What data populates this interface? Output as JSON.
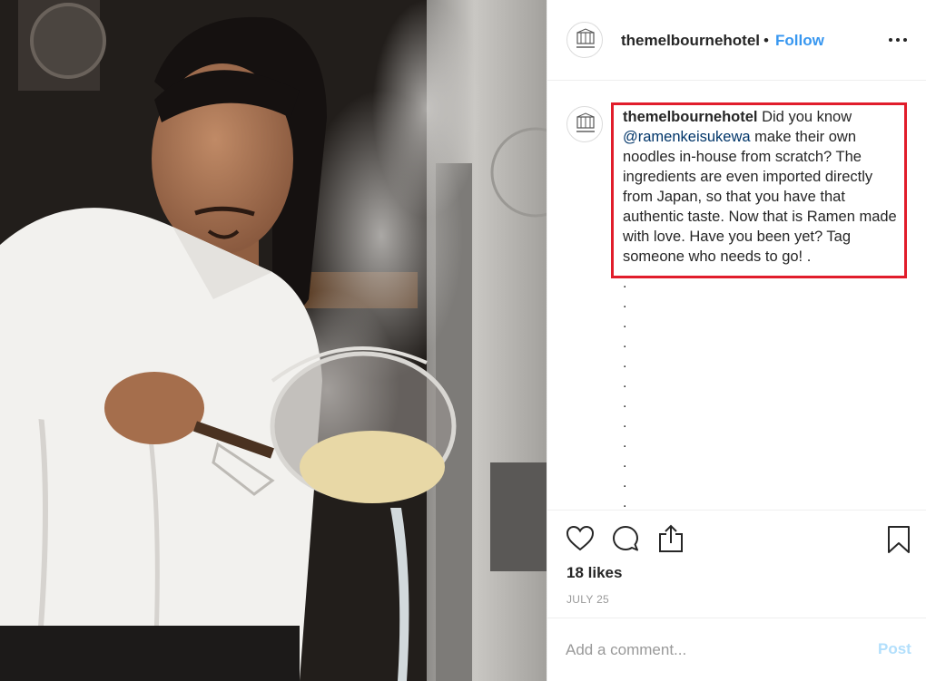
{
  "post": {
    "photo_alt": "Chef straining ramen noodles in a steaming kitchen",
    "account": {
      "username": "themelbournehotel",
      "separator": "•",
      "follow_label": "Follow"
    },
    "caption": {
      "username": "themelbournehotel",
      "text_before": " Did you know ",
      "mention": "@ramenkeisukewa",
      "text_after": " make their own noodles in-house from scratch? The ingredients are even imported directly from Japan, so that you have that authentic taste. Now that is Ramen made with love. Have you been yet? Tag someone who needs to go! .",
      "dots": [
        ".",
        ".",
        ".",
        ".",
        ".",
        ".",
        ".",
        ".",
        ".",
        ".",
        ".",
        "."
      ]
    },
    "stats": {
      "likes": "18 likes",
      "date": "JULY 25"
    },
    "comment_box": {
      "placeholder": "Add a comment...",
      "post_label": "Post"
    },
    "icons": {
      "more": "more-options-icon",
      "like": "heart-icon",
      "comment": "comment-icon",
      "share": "share-icon",
      "save": "bookmark-icon"
    },
    "colors": {
      "link_blue": "#3897f0",
      "highlight_border": "#e11d2b",
      "post_disabled": "#b2dffc",
      "muted_text": "#999999"
    }
  }
}
